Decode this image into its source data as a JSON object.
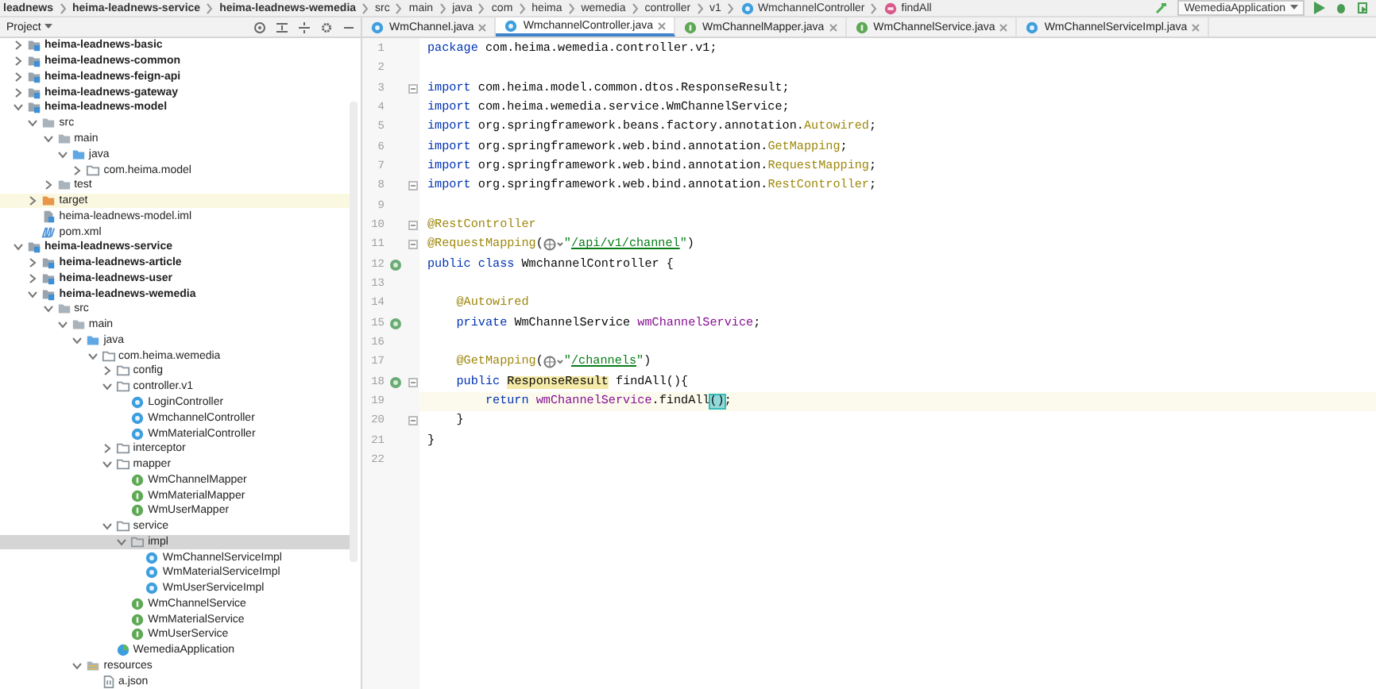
{
  "navbar": {
    "crumbs": [
      {
        "label": "leadnews",
        "kind": "module"
      },
      {
        "label": "heima-leadnews-service",
        "kind": "module"
      },
      {
        "label": "heima-leadnews-wemedia",
        "kind": "module"
      },
      {
        "label": "src",
        "kind": "folder"
      },
      {
        "label": "main",
        "kind": "folder"
      },
      {
        "label": "java",
        "kind": "folder"
      },
      {
        "label": "com",
        "kind": "folder"
      },
      {
        "label": "heima",
        "kind": "folder"
      },
      {
        "label": "wemedia",
        "kind": "folder"
      },
      {
        "label": "controller",
        "kind": "folder"
      },
      {
        "label": "v1",
        "kind": "folder"
      },
      {
        "label": "WmchannelController",
        "kind": "class"
      },
      {
        "label": "findAll",
        "kind": "method"
      }
    ],
    "run_config": "WemediaApplication"
  },
  "project_panel": {
    "title": "Project"
  },
  "tabs": [
    {
      "label": "WmChannel.java",
      "kind": "class",
      "selected": false
    },
    {
      "label": "WmchannelController.java",
      "kind": "class",
      "selected": true
    },
    {
      "label": "WmChannelMapper.java",
      "kind": "interface",
      "selected": false
    },
    {
      "label": "WmChannelService.java",
      "kind": "interface",
      "selected": false
    },
    {
      "label": "WmChannelServiceImpl.java",
      "kind": "class",
      "selected": false
    }
  ],
  "tree": {
    "items": [
      {
        "label": "heima-leadnews-basic",
        "kind": "module",
        "expanded": false,
        "selected": false,
        "highlighted": false
      },
      {
        "label": "heima-leadnews-common",
        "kind": "module",
        "expanded": false,
        "selected": false,
        "highlighted": false
      },
      {
        "label": "heima-leadnews-feign-api",
        "kind": "module",
        "expanded": false,
        "selected": false,
        "highlighted": false
      },
      {
        "label": "heima-leadnews-gateway",
        "kind": "module",
        "expanded": false,
        "selected": false,
        "highlighted": false
      },
      {
        "label": "heima-leadnews-model",
        "kind": "module",
        "expanded": true,
        "selected": false,
        "highlighted": false,
        "children": [
          {
            "label": "src",
            "kind": "folder",
            "expanded": true,
            "selected": false,
            "highlighted": false,
            "children": [
              {
                "label": "main",
                "kind": "folder",
                "expanded": true,
                "selected": false,
                "highlighted": false,
                "children": [
                  {
                    "label": "java",
                    "kind": "source-root",
                    "expanded": true,
                    "selected": false,
                    "highlighted": false,
                    "children": [
                      {
                        "label": "com.heima.model",
                        "kind": "package",
                        "expanded": false,
                        "selected": false,
                        "highlighted": false
                      }
                    ]
                  }
                ]
              },
              {
                "label": "test",
                "kind": "folder",
                "expanded": false,
                "selected": false,
                "highlighted": false
              }
            ]
          },
          {
            "label": "target",
            "kind": "excluded",
            "expanded": false,
            "selected": false,
            "highlighted": true
          },
          {
            "label": "heima-leadnews-model.iml",
            "kind": "iml",
            "selected": false,
            "highlighted": false
          },
          {
            "label": "pom.xml",
            "kind": "pom",
            "selected": false,
            "highlighted": false
          }
        ]
      },
      {
        "label": "heima-leadnews-service",
        "kind": "module",
        "expanded": true,
        "selected": false,
        "highlighted": false,
        "children": [
          {
            "label": "heima-leadnews-article",
            "kind": "module",
            "expanded": false,
            "selected": false,
            "highlighted": false
          },
          {
            "label": "heima-leadnews-user",
            "kind": "module",
            "expanded": false,
            "selected": false,
            "highlighted": false
          },
          {
            "label": "heima-leadnews-wemedia",
            "kind": "module",
            "expanded": true,
            "selected": false,
            "highlighted": false,
            "children": [
              {
                "label": "src",
                "kind": "folder",
                "expanded": true,
                "selected": false,
                "highlighted": false,
                "children": [
                  {
                    "label": "main",
                    "kind": "folder",
                    "expanded": true,
                    "selected": false,
                    "highlighted": false,
                    "children": [
                      {
                        "label": "java",
                        "kind": "source-root",
                        "expanded": true,
                        "selected": false,
                        "highlighted": false,
                        "children": [
                          {
                            "label": "com.heima.wemedia",
                            "kind": "package",
                            "expanded": true,
                            "selected": false,
                            "highlighted": false,
                            "children": [
                              {
                                "label": "config",
                                "kind": "package",
                                "expanded": false,
                                "selected": false,
                                "highlighted": false
                              },
                              {
                                "label": "controller.v1",
                                "kind": "package",
                                "expanded": true,
                                "selected": false,
                                "highlighted": false,
                                "children": [
                                  {
                                    "label": "LoginController",
                                    "kind": "class",
                                    "selected": false,
                                    "highlighted": false
                                  },
                                  {
                                    "label": "WmchannelController",
                                    "kind": "class",
                                    "selected": false,
                                    "highlighted": false
                                  },
                                  {
                                    "label": "WmMaterialController",
                                    "kind": "class",
                                    "selected": false,
                                    "highlighted": false
                                  }
                                ]
                              },
                              {
                                "label": "interceptor",
                                "kind": "package",
                                "expanded": false,
                                "selected": false,
                                "highlighted": false
                              },
                              {
                                "label": "mapper",
                                "kind": "package",
                                "expanded": true,
                                "selected": false,
                                "highlighted": false,
                                "children": [
                                  {
                                    "label": "WmChannelMapper",
                                    "kind": "interface",
                                    "selected": false,
                                    "highlighted": false
                                  },
                                  {
                                    "label": "WmMaterialMapper",
                                    "kind": "interface",
                                    "selected": false,
                                    "highlighted": false
                                  },
                                  {
                                    "label": "WmUserMapper",
                                    "kind": "interface",
                                    "selected": false,
                                    "highlighted": false
                                  }
                                ]
                              },
                              {
                                "label": "service",
                                "kind": "package",
                                "expanded": true,
                                "selected": false,
                                "highlighted": false,
                                "children": [
                                  {
                                    "label": "impl",
                                    "kind": "package",
                                    "expanded": true,
                                    "selected": true,
                                    "highlighted": false,
                                    "children": [
                                      {
                                        "label": "WmChannelServiceImpl",
                                        "kind": "class",
                                        "selected": false,
                                        "highlighted": false
                                      },
                                      {
                                        "label": "WmMaterialServiceImpl",
                                        "kind": "class",
                                        "selected": false,
                                        "highlighted": false
                                      },
                                      {
                                        "label": "WmUserServiceImpl",
                                        "kind": "class",
                                        "selected": false,
                                        "highlighted": false
                                      }
                                    ]
                                  },
                                  {
                                    "label": "WmChannelService",
                                    "kind": "interface",
                                    "selected": false,
                                    "highlighted": false
                                  },
                                  {
                                    "label": "WmMaterialService",
                                    "kind": "interface",
                                    "selected": false,
                                    "highlighted": false
                                  },
                                  {
                                    "label": "WmUserService",
                                    "kind": "interface",
                                    "selected": false,
                                    "highlighted": false
                                  }
                                ]
                              },
                              {
                                "label": "WemediaApplication",
                                "kind": "app",
                                "selected": false,
                                "highlighted": false
                              }
                            ]
                          }
                        ]
                      },
                      {
                        "label": "resources",
                        "kind": "resources",
                        "expanded": true,
                        "selected": false,
                        "highlighted": false,
                        "children": [
                          {
                            "label": "a.json",
                            "kind": "json",
                            "selected": false,
                            "highlighted": false
                          }
                        ]
                      }
                    ]
                  }
                ]
              }
            ]
          }
        ]
      }
    ]
  },
  "editor": {
    "lines": [
      {
        "number": "1",
        "current": false,
        "bean": false,
        "fold": false,
        "tokens": [
          {
            "kind": "keyword",
            "text": "package"
          },
          {
            "kind": "plain",
            "text": " com.heima.wemedia.controller.v1;"
          }
        ]
      },
      {
        "number": "2",
        "current": false,
        "bean": false,
        "fold": false
      },
      {
        "number": "3",
        "current": false,
        "bean": false,
        "fold": true,
        "tokens": [
          {
            "kind": "keyword",
            "text": "import"
          },
          {
            "kind": "plain",
            "text": " com.heima.model.common.dtos.ResponseResult;"
          }
        ]
      },
      {
        "number": "4",
        "current": false,
        "bean": false,
        "fold": false,
        "tokens": [
          {
            "kind": "keyword",
            "text": "import"
          },
          {
            "kind": "plain",
            "text": " com.heima.wemedia.service.WmChannelService;"
          }
        ]
      },
      {
        "number": "5",
        "current": false,
        "bean": false,
        "fold": false,
        "tokens": [
          {
            "kind": "keyword",
            "text": "import"
          },
          {
            "kind": "plain",
            "text": " org.springframework.beans.factory.annotation."
          },
          {
            "kind": "annotation",
            "text": "Autowired"
          },
          {
            "kind": "plain",
            "text": ";"
          }
        ]
      },
      {
        "number": "6",
        "current": false,
        "bean": false,
        "fold": false,
        "tokens": [
          {
            "kind": "keyword",
            "text": "import"
          },
          {
            "kind": "plain",
            "text": " org.springframework.web.bind.annotation."
          },
          {
            "kind": "annotation",
            "text": "GetMapping"
          },
          {
            "kind": "plain",
            "text": ";"
          }
        ]
      },
      {
        "number": "7",
        "current": false,
        "bean": false,
        "fold": false,
        "tokens": [
          {
            "kind": "keyword",
            "text": "import"
          },
          {
            "kind": "plain",
            "text": " org.springframework.web.bind.annotation."
          },
          {
            "kind": "annotation",
            "text": "RequestMapping"
          },
          {
            "kind": "plain",
            "text": ";"
          }
        ]
      },
      {
        "number": "8",
        "current": false,
        "bean": false,
        "fold": true,
        "tokens": [
          {
            "kind": "keyword",
            "text": "import"
          },
          {
            "kind": "plain",
            "text": " org.springframework.web.bind.annotation."
          },
          {
            "kind": "annotation",
            "text": "RestController"
          },
          {
            "kind": "plain",
            "text": ";"
          }
        ]
      },
      {
        "number": "9",
        "current": false,
        "bean": false,
        "fold": false
      },
      {
        "number": "10",
        "current": false,
        "bean": false,
        "fold": true,
        "tokens": [
          {
            "kind": "annotation",
            "text": "@RestController"
          }
        ]
      },
      {
        "number": "11",
        "current": false,
        "bean": false,
        "fold": true,
        "tokens": [
          {
            "kind": "annotation",
            "text": "@RequestMapping"
          },
          {
            "kind": "plain",
            "text": "("
          },
          {
            "kind": "inlay"
          },
          {
            "kind": "string",
            "text": "\""
          },
          {
            "kind": "url",
            "text": "/api/v1/channel"
          },
          {
            "kind": "string",
            "text": "\""
          },
          {
            "kind": "plain",
            "text": ")"
          }
        ]
      },
      {
        "number": "12",
        "current": false,
        "bean": true,
        "fold": false,
        "tokens": [
          {
            "kind": "keyword",
            "text": "public class"
          },
          {
            "kind": "plain",
            "text": " WmchannelController {"
          }
        ]
      },
      {
        "number": "13",
        "current": false,
        "bean": false,
        "fold": false
      },
      {
        "number": "14",
        "current": false,
        "bean": false,
        "fold": false,
        "tokens": [
          {
            "kind": "annotation",
            "text": "    @Autowired"
          }
        ]
      },
      {
        "number": "15",
        "current": false,
        "bean": true,
        "fold": false,
        "tokens": [
          {
            "kind": "keyword",
            "text": "    private"
          },
          {
            "kind": "plain",
            "text": " WmChannelService "
          },
          {
            "kind": "field",
            "text": "wmChannelService"
          },
          {
            "kind": "plain",
            "text": ";"
          }
        ]
      },
      {
        "number": "16",
        "current": false,
        "bean": false,
        "fold": false
      },
      {
        "number": "17",
        "current": false,
        "bean": false,
        "fold": false,
        "tokens": [
          {
            "kind": "annotation",
            "text": "    @GetMapping"
          },
          {
            "kind": "plain",
            "text": "("
          },
          {
            "kind": "inlay"
          },
          {
            "kind": "string",
            "text": "\""
          },
          {
            "kind": "url",
            "text": "/channels"
          },
          {
            "kind": "string",
            "text": "\""
          },
          {
            "kind": "plain",
            "text": ")"
          }
        ]
      },
      {
        "number": "18",
        "current": false,
        "bean": true,
        "fold": true,
        "tokens": [
          {
            "kind": "keyword",
            "text": "    public "
          },
          {
            "kind": "usage",
            "text": "ResponseResult"
          },
          {
            "kind": "plain",
            "text": " findAll(){"
          }
        ]
      },
      {
        "number": "19",
        "current": true,
        "bean": false,
        "fold": false,
        "tokens": [
          {
            "kind": "keyword",
            "text": "        return "
          },
          {
            "kind": "field",
            "text": "wmChannelService"
          },
          {
            "kind": "plain",
            "text": ".findAll"
          },
          {
            "kind": "brace",
            "text": "()"
          },
          {
            "kind": "plain",
            "text": ";"
          }
        ]
      },
      {
        "number": "20",
        "current": false,
        "bean": false,
        "fold": true,
        "tokens": [
          {
            "kind": "plain",
            "text": "    }"
          }
        ]
      },
      {
        "number": "21",
        "current": false,
        "bean": false,
        "fold": false,
        "tokens": [
          {
            "kind": "plain",
            "text": "}"
          }
        ]
      },
      {
        "number": "22",
        "current": false,
        "bean": false,
        "fold": false
      }
    ]
  }
}
